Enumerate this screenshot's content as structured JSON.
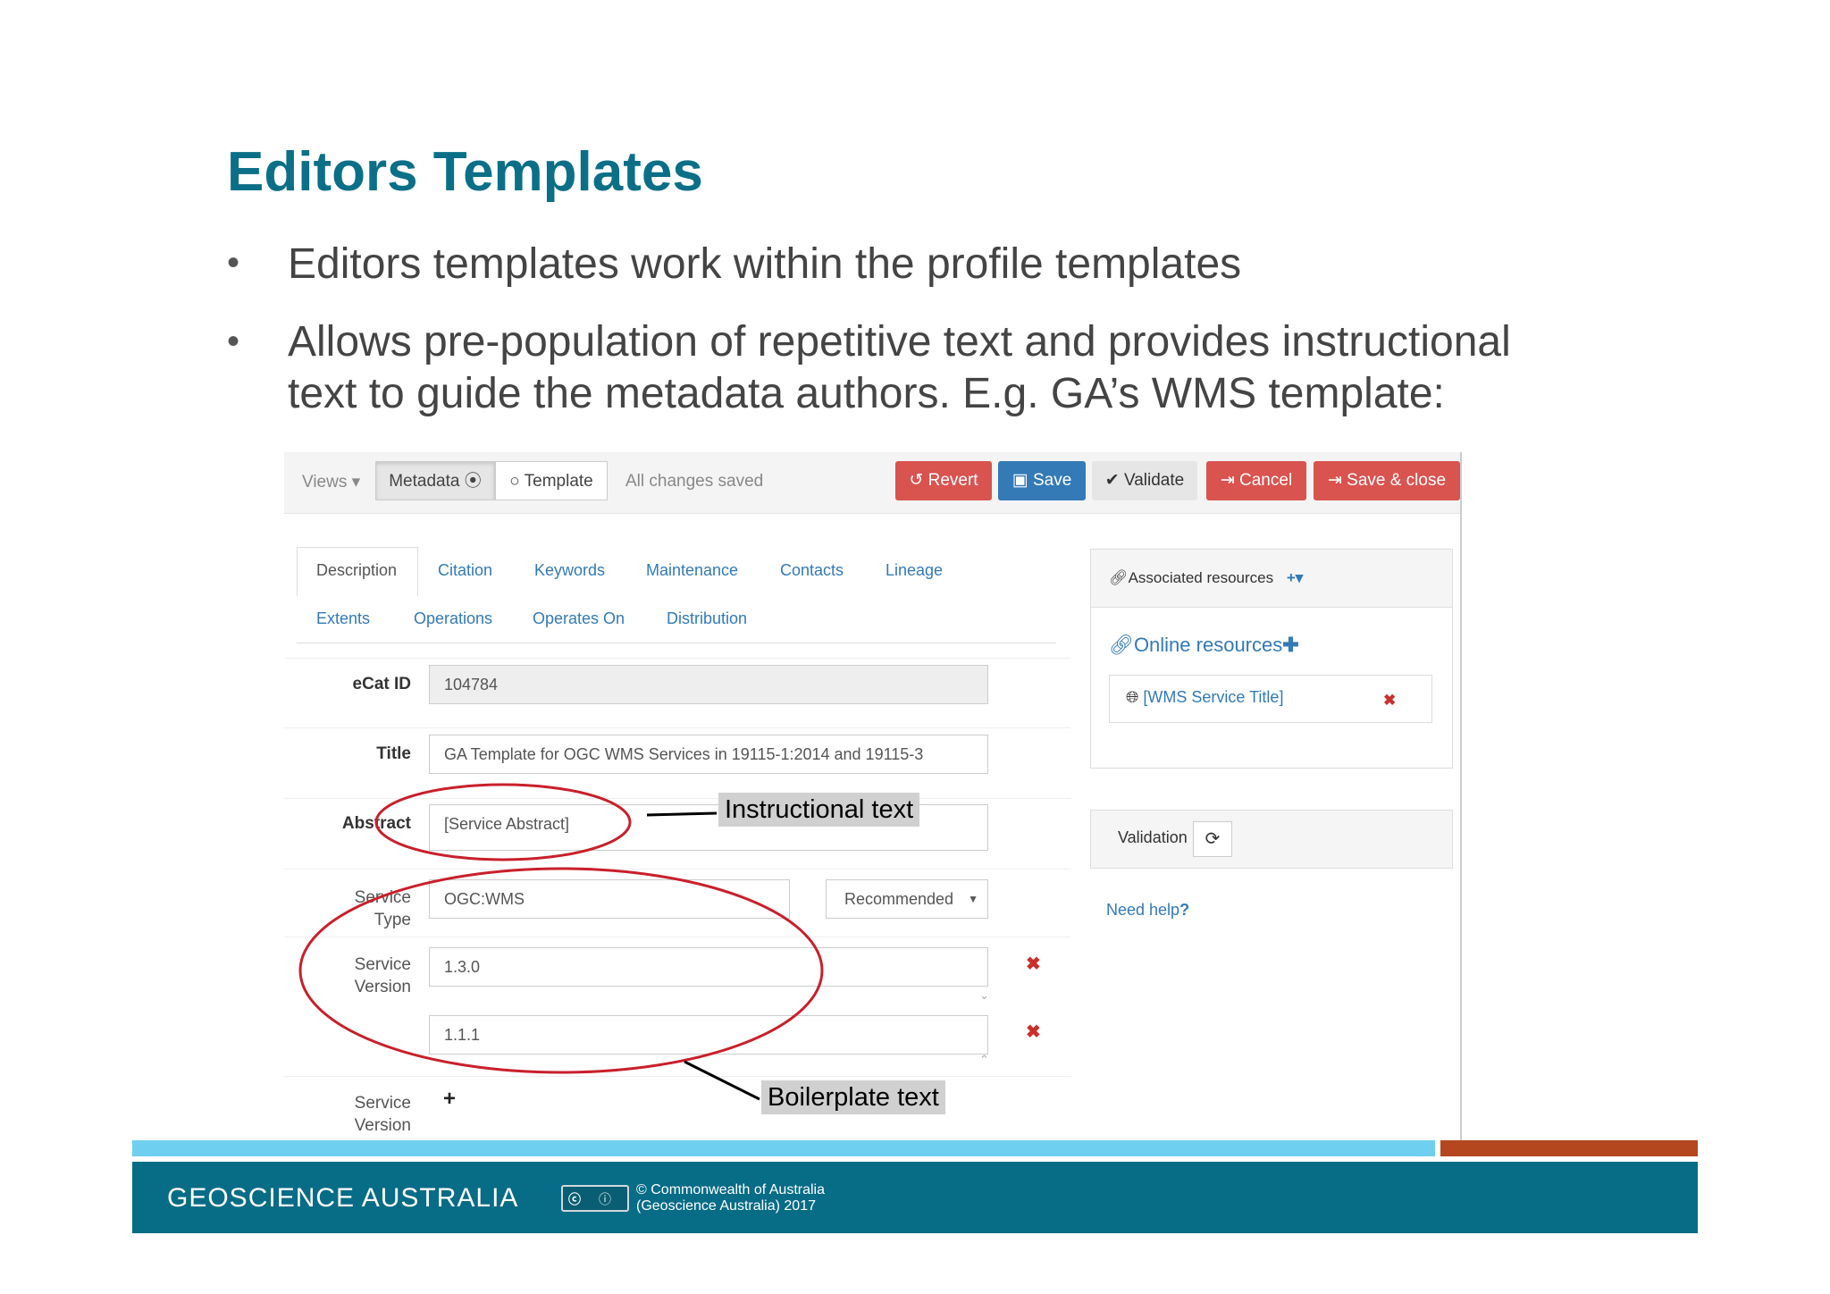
{
  "slide": {
    "title": "Editors Templates",
    "bullets": [
      {
        "lines": [
          "Editors templates work within the profile templates"
        ]
      },
      {
        "lines": [
          "Allows pre-population of repetitive text and provides instructional",
          "text to guide the metadata authors. E.g. GA’s WMS template:"
        ]
      }
    ]
  },
  "toolbar": {
    "views_label": "Views",
    "metadata_label": "Metadata",
    "template_label": "Template",
    "status_text": "All changes saved",
    "revert_label": "Revert",
    "save_label": "Save",
    "validate_label": "Validate",
    "cancel_label": "Cancel",
    "save_close_label": "Save & close"
  },
  "tabs": {
    "row1": [
      "Description",
      "Citation",
      "Keywords",
      "Maintenance",
      "Contacts",
      "Lineage"
    ],
    "row2": [
      "Extents",
      "Operations",
      "Operates On",
      "Distribution"
    ],
    "active": "Description"
  },
  "form": {
    "ecat_id": {
      "label": "eCat ID",
      "value": "104784"
    },
    "title": {
      "label": "Title",
      "value": "GA Template for OGC WMS Services in 19115-1:2014 and 19115-3"
    },
    "abstract": {
      "label": "Abstract",
      "value": "[Service Abstract]"
    },
    "service_type": {
      "label_line1": "Service",
      "label_line2": "Type",
      "value": "OGC:WMS",
      "select_value": "Recommended"
    },
    "service_version": {
      "label_line1": "Service",
      "label_line2": "Version",
      "values": [
        "1.3.0",
        "1.1.1"
      ]
    },
    "service_version_add": {
      "label_line1": "Service",
      "label_line2": "Version"
    }
  },
  "sidebar": {
    "associated_resources_label": "Associated resources",
    "online_resources_label": "Online resources",
    "online_resource_item": "[WMS Service Title]",
    "validation_label": "Validation",
    "need_help_label": "Need help"
  },
  "annotations": {
    "instructional": "Instructional text",
    "boilerplate": "Boilerplate text",
    "ellipse_color": "#c8202c"
  },
  "footer": {
    "brand": "GEOSCIENCE AUSTRALIA",
    "copyright_line1": "© Commonwealth of Australia",
    "copyright_line2": "(Geoscience Australia) 2017",
    "colors": {
      "band": "#076c86",
      "bar_blue": "#6fcff0",
      "bar_orange": "#b5471f",
      "title": "#0b6f87"
    }
  }
}
